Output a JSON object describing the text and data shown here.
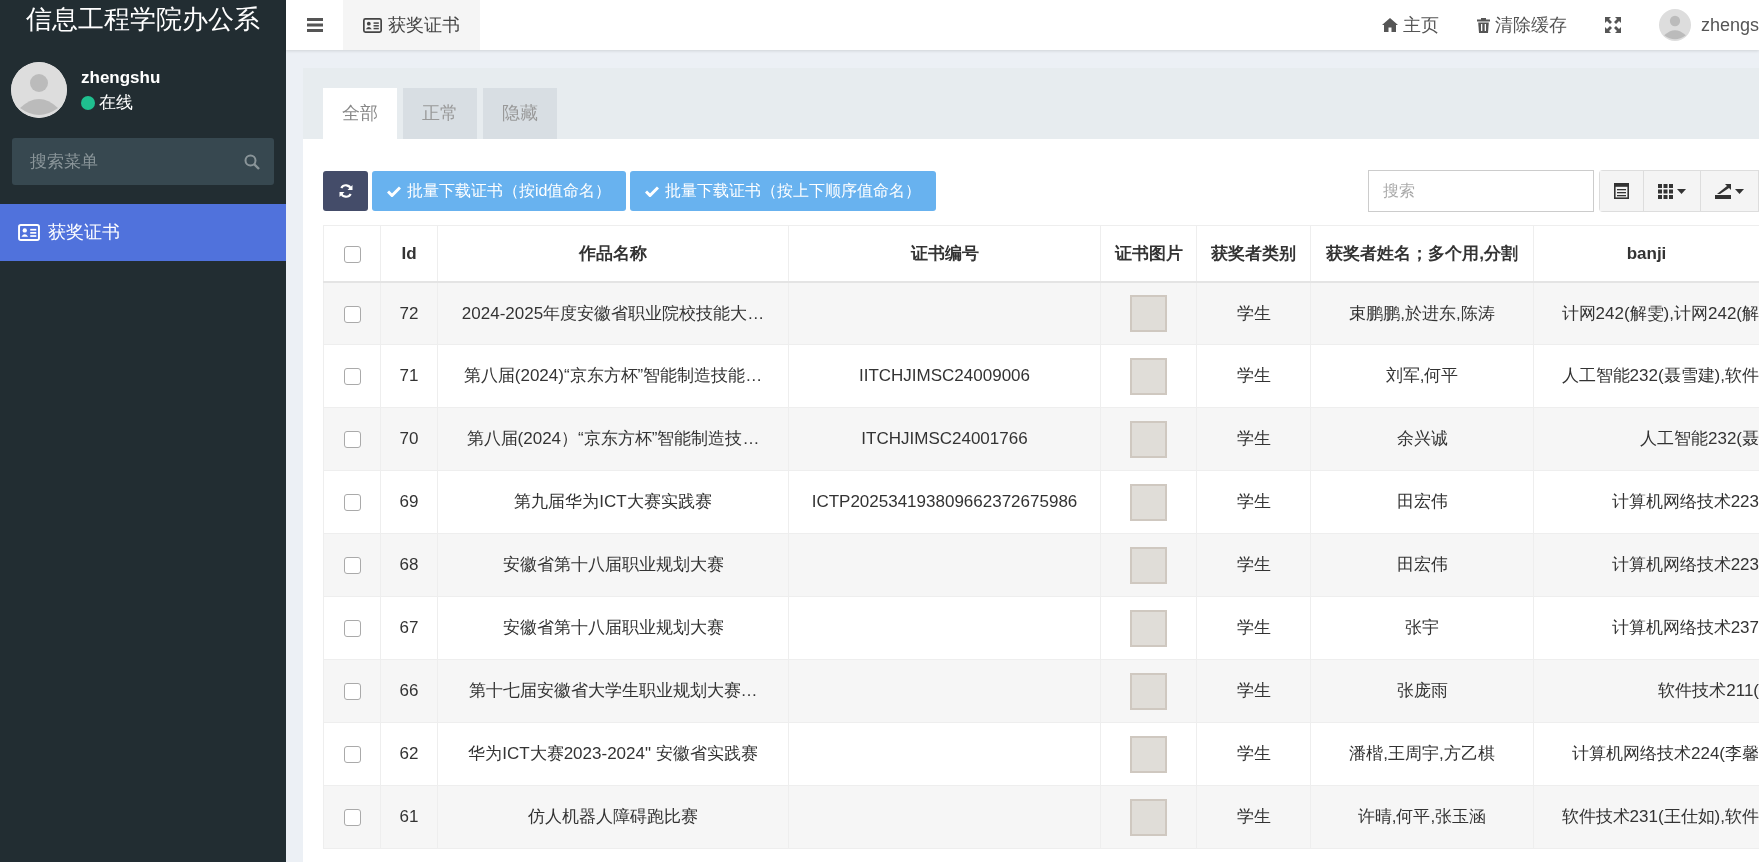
{
  "sidebar": {
    "title": "信息工程学院办公系",
    "user": {
      "name": "zhengshu",
      "status": "在线",
      "online": true
    },
    "search": {
      "placeholder": "搜索菜单"
    },
    "items": [
      {
        "label": "获奖证书",
        "selected": true
      }
    ]
  },
  "header": {
    "tabs": [
      {
        "label": "获奖证书",
        "selected": true
      }
    ],
    "links": [
      {
        "kind": "home",
        "label": "主页"
      },
      {
        "kind": "trash",
        "label": "清除缓存"
      },
      {
        "kind": "fullscreen"
      }
    ],
    "user": "zhengs"
  },
  "tabs": [
    {
      "label": "全部",
      "selected": true
    },
    {
      "label": "正常",
      "selected": false
    },
    {
      "label": "隐藏",
      "selected": false
    }
  ],
  "toolbar": {
    "buttons": [
      {
        "kind": "refresh"
      },
      {
        "kind": "download",
        "label": "批量下载证书（按id值命名）"
      },
      {
        "kind": "download",
        "label": "批量下载证书（按上下顺序值命名）"
      }
    ],
    "search": {
      "placeholder": "搜索"
    },
    "tools": [
      {
        "kind": "list"
      },
      {
        "kind": "columns"
      },
      {
        "kind": "export"
      }
    ]
  },
  "table": {
    "all_checked": false,
    "columns": [
      "Id",
      "作品名称",
      "证书编号",
      "证书图片",
      "获奖者类别",
      "获奖者姓名；多个用,分割",
      "banji"
    ],
    "rows": [
      {
        "checked": false,
        "id": "72",
        "title": "2024-2025年度安徽省职业院校技能大…",
        "category": "学生",
        "winners": "束鹏鹏,於进东,陈涛",
        "banji": "计网242(解雯),计网242(解"
      },
      {
        "checked": false,
        "id": "71",
        "title": "第八届(2024)“京东方杯”智能制造技能…",
        "cert_no": "IITCHJIMSC24009006",
        "category": "学生",
        "winners": "刘军,何平",
        "banji": "人工智能232(聂雪建),软件"
      },
      {
        "checked": false,
        "id": "70",
        "title": "第八届(2024）“京东方杯”智能制造技…",
        "cert_no": "ITCHJIMSC24001766",
        "category": "学生",
        "winners": "余兴诚",
        "banji": "人工智能232(聂"
      },
      {
        "checked": false,
        "id": "69",
        "title": "第九届华为ICT大赛实践赛",
        "cert_no": "ICTP202534193809662372675986",
        "category": "学生",
        "winners": "田宏伟",
        "banji": "计算机网络技术223"
      },
      {
        "checked": false,
        "id": "68",
        "title": "安徽省第十八届职业规划大赛",
        "category": "学生",
        "winners": "田宏伟",
        "banji": "计算机网络技术223"
      },
      {
        "checked": false,
        "id": "67",
        "title": "安徽省第十八届职业规划大赛",
        "category": "学生",
        "winners": "张宇",
        "banji": "计算机网络技术237"
      },
      {
        "checked": false,
        "id": "66",
        "title": "第十七届安徽省大学生职业规划大赛…",
        "category": "学生",
        "winners": "张庞雨",
        "banji": "软件技术211("
      },
      {
        "checked": false,
        "id": "62",
        "title": "华为ICT大赛2023-2024\" 安徽省实践赛",
        "category": "学生",
        "winners": "潘楷,王周宇,方乙棋",
        "banji": "计算机网络技术224(李馨"
      },
      {
        "checked": false,
        "id": "61",
        "title": "仿人机器人障碍跑比赛",
        "category": "学生",
        "winners": "许晴,何平,张玉涵",
        "banji": "软件技术231(王仕如),软件"
      }
    ]
  }
}
